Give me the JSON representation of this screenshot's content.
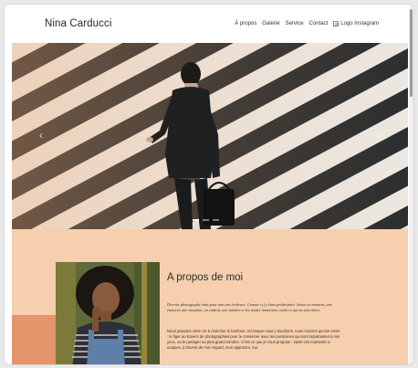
{
  "site": {
    "brand": "Nina Carducci",
    "nav": [
      "À propos",
      "Galerie",
      "Service",
      "Contact"
    ],
    "instagram_alt": "Logo Instagram"
  },
  "hero": {
    "arrows": [
      "‹",
      "›"
    ],
    "dots": 3,
    "active_dot": 0
  },
  "about": {
    "title": "A propos de moi",
    "quote": "Devenir photographe était pour moi une évidence. Comme si j'y étais prédestinée. Saisir un moment, une émotion, une situation, un endroit, une lumière et les rendre immortels, voilà ce qui me fait vibrer.",
    "paragraph": "Nous passons notre vie à chercher le bonheur, et lorsque nous y touchons, nous n'avons qu'une envie : le figer au travers de photographies pour le conserver avec les personnes qui sont importantes à nos yeux, ou le partager au plus grand nombre. C'est ce que je vous propose : saisir ces moments si uniques, à travers de mon regard, mon approche, ma"
  },
  "colors": {
    "about_bg": "#f6cfae",
    "accent_block": "#e4956b"
  }
}
